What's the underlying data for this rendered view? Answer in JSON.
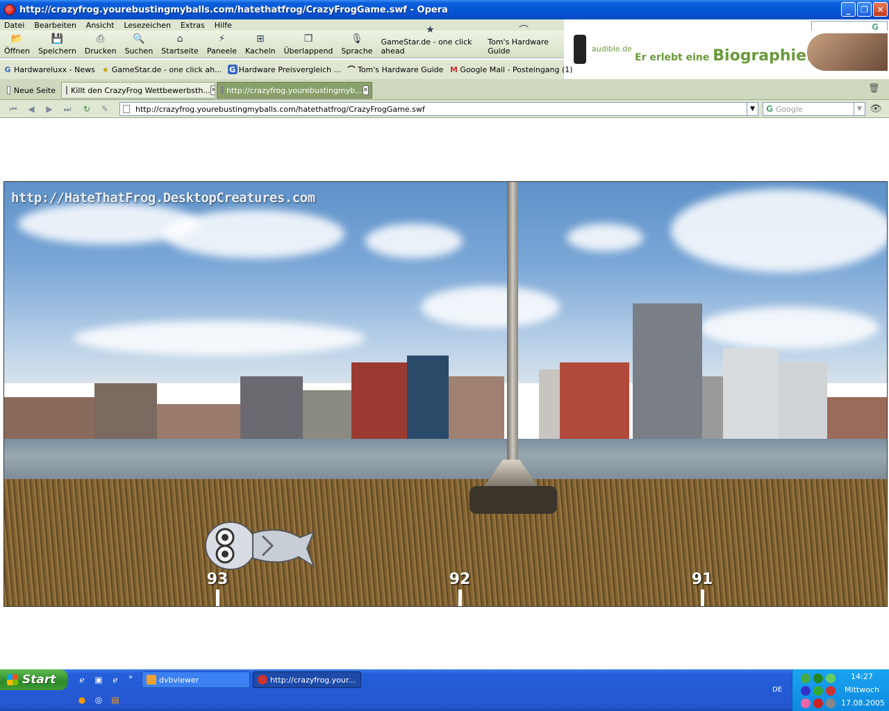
{
  "window": {
    "title": "http://crazyfrog.yourebustingmyballs.com/hatethatfrog/CrazyFrogGame.swf - Opera"
  },
  "menu": [
    "Datei",
    "Bearbeiten",
    "Ansicht",
    "Lesezeichen",
    "Extras",
    "Hilfe"
  ],
  "toolbar": [
    {
      "label": "Öffnen",
      "icon": "folder-open-icon",
      "glyph": "📂"
    },
    {
      "label": "Speichern",
      "icon": "save-icon",
      "glyph": "💾"
    },
    {
      "label": "Drucken",
      "icon": "printer-icon",
      "glyph": "⎙"
    },
    {
      "label": "Suchen",
      "icon": "search-icon",
      "glyph": "🔍"
    },
    {
      "label": "Startseite",
      "icon": "home-icon",
      "glyph": "⌂"
    },
    {
      "label": "Paneele",
      "icon": "panels-icon",
      "glyph": "⚡"
    },
    {
      "label": "Kacheln",
      "icon": "tile-icon",
      "glyph": "⊞"
    },
    {
      "label": "Überlappend",
      "icon": "cascade-icon",
      "glyph": "❐"
    },
    {
      "label": "Sprache",
      "icon": "microphone-icon",
      "glyph": "🎙"
    },
    {
      "label": "GameStar.de - one click ahead",
      "icon": "gamestar-icon",
      "glyph": "★"
    },
    {
      "label": "Tom's Hardware Guide",
      "icon": "toms-hardware-icon",
      "glyph": "⌒"
    }
  ],
  "ad": {
    "brand": "audible.de",
    "slogan_prefix": "Er erlebt eine",
    "slogan_word": "Biographie."
  },
  "bookmarks": [
    {
      "label": "Hardwareluxx - News",
      "icon": "hardwareluxx-icon",
      "glyph": "G"
    },
    {
      "label": "GameStar.de - one click ah...",
      "icon": "gamestar-icon",
      "glyph": "★"
    },
    {
      "label": "Hardware Preisvergleich ...",
      "icon": "geizhals-icon",
      "glyph": "G"
    },
    {
      "label": "Tom's Hardware Guide",
      "icon": "toms-hardware-icon",
      "glyph": "⌒"
    },
    {
      "label": "Google Mail - Posteingang (1)",
      "icon": "gmail-icon",
      "glyph": "M"
    }
  ],
  "tabs": {
    "new_page": "Neue Seite",
    "tab1": "Killt den CrazyFrog Wettbewerbsth...",
    "tab2": "http://crazyfrog.yourebustingmyb..."
  },
  "address": {
    "url": "http://crazyfrog.yourebustingmyballs.com/hatethatfrog/CrazyFrogGame.swf",
    "search_placeholder": "Google"
  },
  "game": {
    "watermark": "http://HateThatFrog.DesktopCreatures.com",
    "markers": [
      "93",
      "92",
      "91"
    ]
  },
  "taskbar": {
    "start": "Start",
    "items": [
      "dvbviewer",
      "http://crazyfrog.your..."
    ],
    "lang": "DE",
    "time": "14:27",
    "day": "Mittwoch",
    "date": "17.08.2005"
  },
  "colors": {
    "titlebar": "#0654d4",
    "taskbar": "#245fd9",
    "start": "#3f9b33",
    "toolbar": "#dde6cf",
    "active_tab": "#8aa06a"
  }
}
